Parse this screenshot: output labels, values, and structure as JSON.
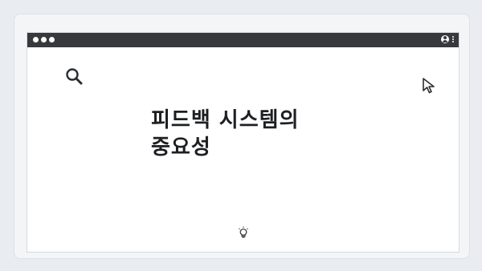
{
  "page": {
    "title_line1": "피드백 시스템의",
    "title_line2": "중요성"
  },
  "icons": {
    "window_controls": "traffic-light-dots",
    "account": "user-icon",
    "menu": "kebab-menu-icon",
    "search": "search-icon",
    "cursor": "cursor-arrow-icon",
    "idea": "lightbulb-icon"
  },
  "colors": {
    "titlebar": "#37393c",
    "background": "#e9edf1",
    "window": "#ffffff",
    "text": "#1d1f22"
  }
}
